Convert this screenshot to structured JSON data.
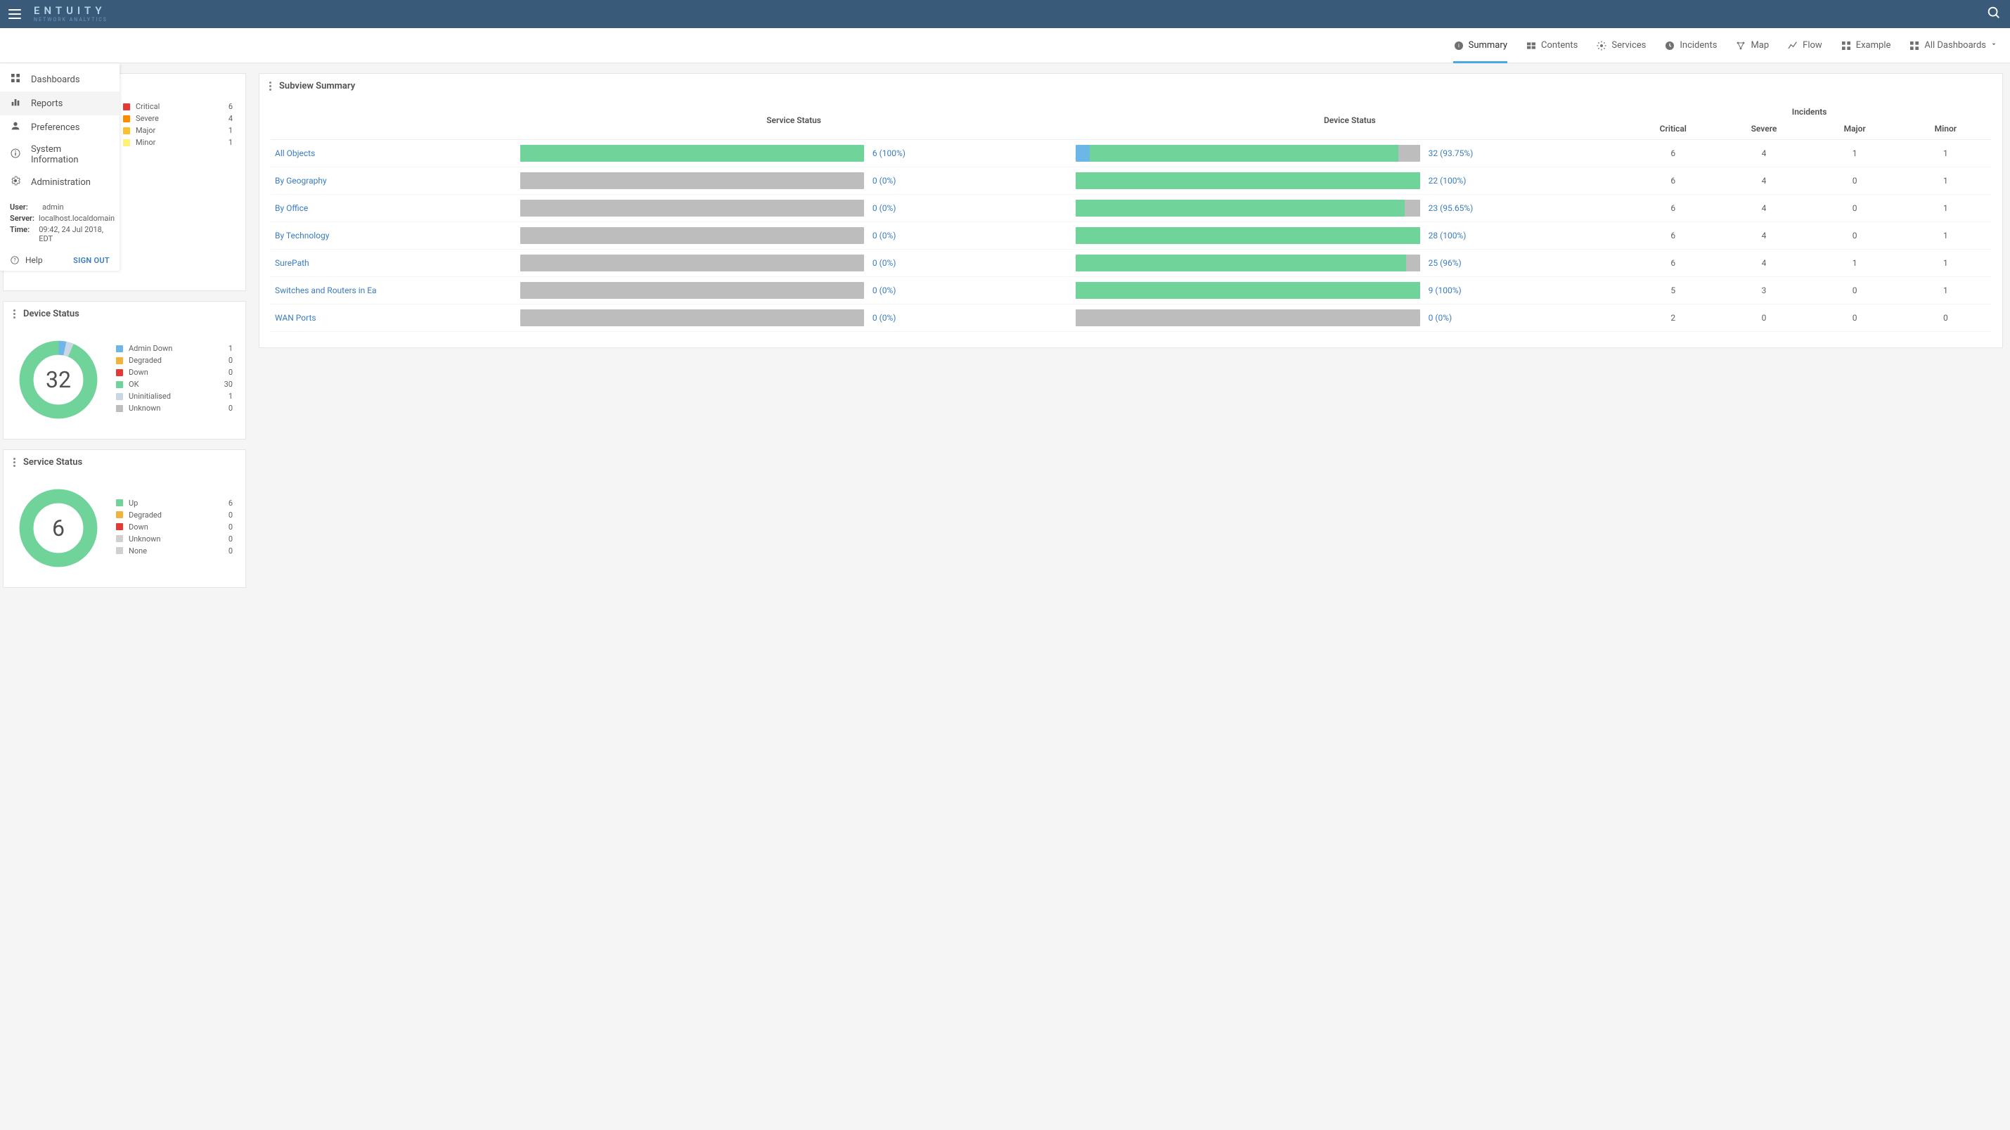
{
  "brand": {
    "name": "ENTUITY",
    "sub": "NETWORK ANALYTICS"
  },
  "tabs": [
    {
      "id": "summary",
      "label": "Summary",
      "active": true
    },
    {
      "id": "contents",
      "label": "Contents"
    },
    {
      "id": "services",
      "label": "Services"
    },
    {
      "id": "incidents",
      "label": "Incidents"
    },
    {
      "id": "map",
      "label": "Map"
    },
    {
      "id": "flow",
      "label": "Flow"
    },
    {
      "id": "example",
      "label": "Example"
    },
    {
      "id": "all-dashboards",
      "label": "All Dashboards",
      "caret": true
    }
  ],
  "nav": {
    "items": [
      {
        "id": "dashboards",
        "label": "Dashboards"
      },
      {
        "id": "reports",
        "label": "Reports",
        "hovered": true
      },
      {
        "id": "preferences",
        "label": "Preferences"
      },
      {
        "id": "system-information",
        "label": "System Information"
      },
      {
        "id": "administration",
        "label": "Administration"
      }
    ],
    "meta": {
      "user_label": "User:",
      "user_value": "admin",
      "server_label": "Server:",
      "server_value": "localhost.localdomain",
      "time_label": "Time:",
      "time_value": "09:42, 24 Jul 2018, EDT"
    },
    "help_label": "Help",
    "signout_label": "SIGN OUT"
  },
  "incident_legend": [
    {
      "label": "Critical",
      "value": 6,
      "color": "#e53935"
    },
    {
      "label": "Severe",
      "value": 4,
      "color": "#fb8c00"
    },
    {
      "label": "Major",
      "value": 1,
      "color": "#fbc02d"
    },
    {
      "label": "Minor",
      "value": 1,
      "color": "#fff176"
    }
  ],
  "device_card": {
    "title": "Device Status",
    "center": "32",
    "legend": [
      {
        "label": "Admin Down",
        "value": 1,
        "color": "#6cb7e8"
      },
      {
        "label": "Degraded",
        "value": 0,
        "color": "#f2b33d"
      },
      {
        "label": "Down",
        "value": 0,
        "color": "#e53935"
      },
      {
        "label": "OK",
        "value": 30,
        "color": "#6fd39a"
      },
      {
        "label": "Uninitialised",
        "value": 1,
        "color": "#c9d6e6"
      },
      {
        "label": "Unknown",
        "value": 0,
        "color": "#bdbdbd"
      }
    ]
  },
  "service_card": {
    "title": "Service Status",
    "center": "6",
    "legend": [
      {
        "label": "Up",
        "value": 6,
        "color": "#6fd39a"
      },
      {
        "label": "Degraded",
        "value": 0,
        "color": "#f2b33d"
      },
      {
        "label": "Down",
        "value": 0,
        "color": "#e53935"
      },
      {
        "label": "Unknown",
        "value": 0,
        "color": "#d0d0d0"
      },
      {
        "label": "None",
        "value": 0,
        "color": "#d0d0d0"
      }
    ]
  },
  "summary": {
    "title": "Subview Summary",
    "columns": {
      "service": "Service Status",
      "device": "Device Status",
      "incidents_group": "Incidents",
      "critical": "Critical",
      "severe": "Severe",
      "major": "Major",
      "minor": "Minor"
    },
    "rows": [
      {
        "name": "All Objects",
        "service_pct": 100,
        "service_label": "6 (100%)",
        "device_pct": 93.75,
        "device_label": "32 (93.75%)",
        "critical": 6,
        "severe": 4,
        "major": 1,
        "minor": 1,
        "device_seg": true
      },
      {
        "name": "By Geography",
        "service_pct": 0,
        "service_label": "0 (0%)",
        "device_pct": 100,
        "device_label": "22 (100%)",
        "critical": 6,
        "severe": 4,
        "major": 0,
        "minor": 1
      },
      {
        "name": "By Office",
        "service_pct": 0,
        "service_label": "0 (0%)",
        "device_pct": 95.65,
        "device_label": "23 (95.65%)",
        "critical": 6,
        "severe": 4,
        "major": 0,
        "minor": 1
      },
      {
        "name": "By Technology",
        "service_pct": 0,
        "service_label": "0 (0%)",
        "device_pct": 100,
        "device_label": "28 (100%)",
        "critical": 6,
        "severe": 4,
        "major": 0,
        "minor": 1
      },
      {
        "name": "SurePath",
        "service_pct": 0,
        "service_label": "0 (0%)",
        "device_pct": 96,
        "device_label": "25 (96%)",
        "critical": 6,
        "severe": 4,
        "major": 1,
        "minor": 1
      },
      {
        "name": "Switches and Routers in Ea",
        "service_pct": 0,
        "service_label": "0 (0%)",
        "device_pct": 100,
        "device_label": "9 (100%)",
        "critical": 5,
        "severe": 3,
        "major": 0,
        "minor": 1
      },
      {
        "name": "WAN Ports",
        "service_pct": 0,
        "service_label": "0 (0%)",
        "device_pct": 0,
        "device_label": "0 (0%)",
        "critical": 2,
        "severe": 0,
        "major": 0,
        "minor": 0
      }
    ]
  },
  "chart_data": [
    {
      "type": "pie",
      "title": "Device Status",
      "series": [
        {
          "name": "Admin Down",
          "value": 1
        },
        {
          "name": "Degraded",
          "value": 0
        },
        {
          "name": "Down",
          "value": 0
        },
        {
          "name": "OK",
          "value": 30
        },
        {
          "name": "Uninitialised",
          "value": 1
        },
        {
          "name": "Unknown",
          "value": 0
        }
      ]
    },
    {
      "type": "pie",
      "title": "Service Status",
      "series": [
        {
          "name": "Up",
          "value": 6
        },
        {
          "name": "Degraded",
          "value": 0
        },
        {
          "name": "Down",
          "value": 0
        },
        {
          "name": "Unknown",
          "value": 0
        },
        {
          "name": "None",
          "value": 0
        }
      ]
    }
  ]
}
